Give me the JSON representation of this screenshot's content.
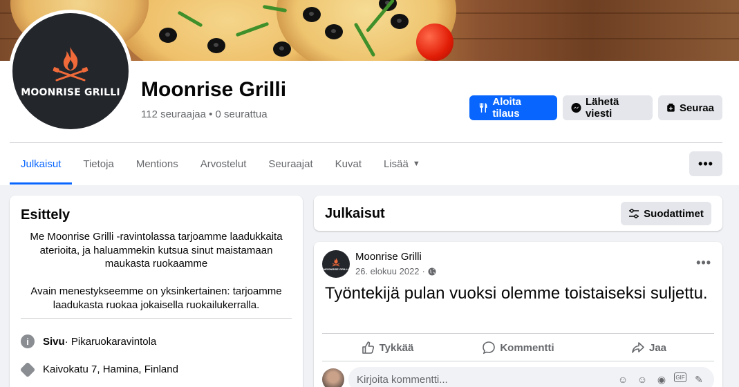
{
  "page": {
    "name": "Moonrise Grilli",
    "logo_text": "MOONRISE GRILLI",
    "stats": "112 seuraajaa • 0 seurattua"
  },
  "buttons": {
    "order": "Aloita tilaus",
    "message": "Lähetä viesti",
    "follow": "Seuraa",
    "more": "•••"
  },
  "tabs": [
    {
      "label": "Julkaisut",
      "active": true
    },
    {
      "label": "Tietoja"
    },
    {
      "label": "Mentions"
    },
    {
      "label": "Arvostelut"
    },
    {
      "label": "Seuraajat"
    },
    {
      "label": "Kuvat"
    },
    {
      "label": "Lisää"
    }
  ],
  "intro": {
    "title": "Esittely",
    "paragraph1": "Me Moonrise Grilli -ravintolassa tarjoamme laadukkaita aterioita, ja haluammekin kutsua sinut maistamaan maukasta ruokaamme",
    "paragraph2": "Avain menestykseemme on yksinkertainen: tarjoamme laadukasta ruokaa jokaisella ruokailukerralla.",
    "category_label": "Sivu",
    "category_value": " · Pikaruokaravintola",
    "address": "Kaivokatu 7, Hamina, Finland"
  },
  "posts_section": {
    "title": "Julkaisut",
    "filter_label": "Suodattimet"
  },
  "post": {
    "author": "Moonrise Grilli",
    "logo_text": "MOONRISE GRILLI",
    "date": "26. elokuu 2022",
    "separator": "·",
    "text": "Työntekijä pulan vuoksi olemme toistaiseksi suljettu.",
    "like": "Tykkää",
    "comment": "Kommentti",
    "share": "Jaa",
    "comment_placeholder": "Kirjoita kommentti..."
  },
  "colors": {
    "accent": "#0866ff",
    "secondary_button": "#e4e6eb",
    "background": "#f0f2f5"
  },
  "icons": {
    "order": "fork-knife-icon",
    "message": "messenger-icon",
    "follow": "follow-icon",
    "filter": "filter-sliders-icon",
    "info": "info-icon",
    "location": "directions-icon",
    "globe": "globe-icon",
    "like": "thumbs-up-icon",
    "comment": "comment-bubble-icon",
    "share": "share-arrow-icon"
  }
}
